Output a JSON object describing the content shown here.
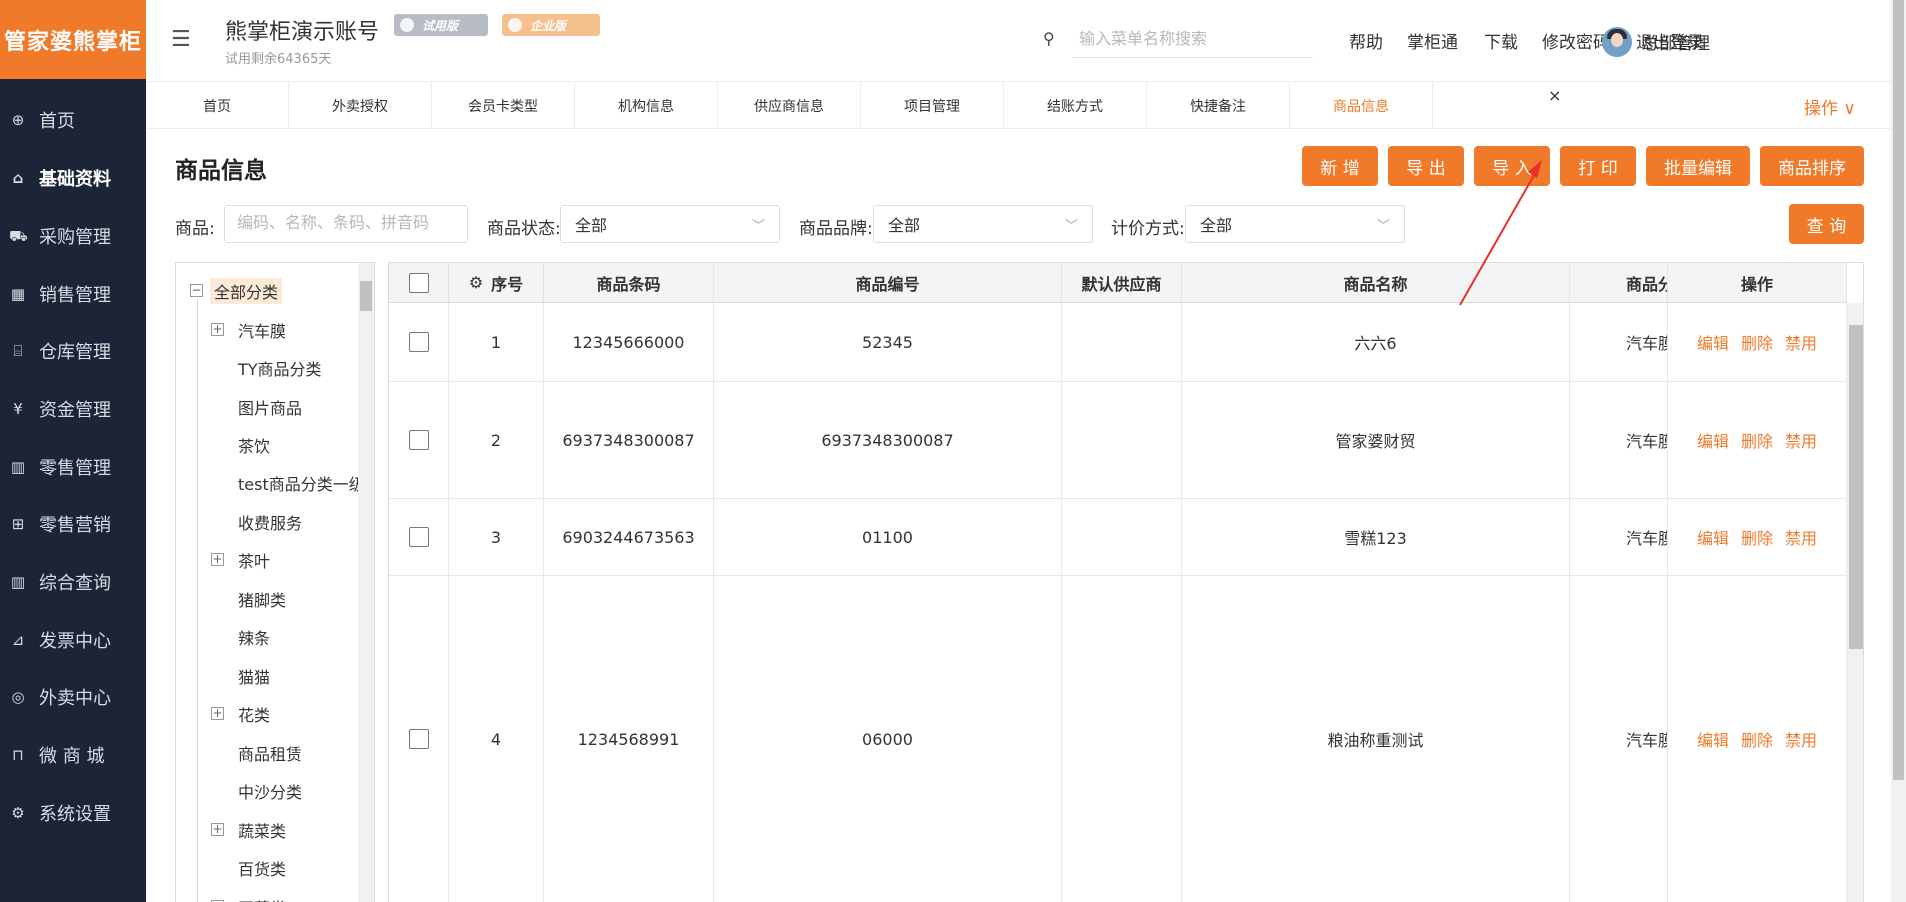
{
  "app": {
    "logo_text": "管家婆熊掌柜",
    "account_name": "熊掌柜演示账号",
    "trial_remaining": "试用剩余64365天",
    "badge_trial": "试用版",
    "badge_enterprise": "企业版",
    "user_name": "总部管理"
  },
  "search": {
    "placeholder": "输入菜单名称搜索"
  },
  "top_links": [
    "帮助",
    "掌柜通",
    "下载",
    "修改密码",
    "退出登录"
  ],
  "sidebar": {
    "items": [
      {
        "label": "首页",
        "icon": "globe-icon"
      },
      {
        "label": "基础资料",
        "icon": "home-icon",
        "active": true
      },
      {
        "label": "采购管理",
        "icon": "cart-icon"
      },
      {
        "label": "销售管理",
        "icon": "calendar-icon"
      },
      {
        "label": "仓库管理",
        "icon": "bank-icon"
      },
      {
        "label": "资金管理",
        "icon": "yen-icon"
      },
      {
        "label": "零售管理",
        "icon": "bar-chart-icon"
      },
      {
        "label": "零售营销",
        "icon": "gift-icon"
      },
      {
        "label": "综合查询",
        "icon": "bar-chart-icon"
      },
      {
        "label": "发票中心",
        "icon": "line-chart-icon"
      },
      {
        "label": "外卖中心",
        "icon": "alarm-icon"
      },
      {
        "label": "微 商 城",
        "icon": "bag-icon"
      },
      {
        "label": "系统设置",
        "icon": "gear-icon"
      }
    ]
  },
  "tabs": [
    {
      "label": "首页"
    },
    {
      "label": "外卖授权"
    },
    {
      "label": "会员卡类型"
    },
    {
      "label": "机构信息"
    },
    {
      "label": "供应商信息"
    },
    {
      "label": "项目管理"
    },
    {
      "label": "结账方式"
    },
    {
      "label": "快捷备注"
    },
    {
      "label": "商品信息",
      "active": true
    }
  ],
  "tab_close": "×",
  "tab_ops": "操作 ∨",
  "page": {
    "title": "商品信息",
    "buttons": [
      "新 增",
      "导 出",
      "导 入",
      "打 印",
      "批量编辑",
      "商品排序"
    ],
    "query_button": "查 询"
  },
  "filters": {
    "goods_label": "商品:",
    "goods_placeholder": "编码、名称、条码、拼音码",
    "status_label": "商品状态:",
    "status_value": "全部",
    "brand_label": "商品品牌:",
    "brand_value": "全部",
    "pricing_label": "计价方式:",
    "pricing_value": "全部"
  },
  "tree": {
    "root": "全部分类",
    "nodes": [
      {
        "label": "汽车膜",
        "expandable": true
      },
      {
        "label": "TY商品分类"
      },
      {
        "label": "图片商品"
      },
      {
        "label": "茶饮"
      },
      {
        "label": "test商品分类一级"
      },
      {
        "label": "收费服务"
      },
      {
        "label": "茶叶",
        "expandable": true
      },
      {
        "label": "猪脚类"
      },
      {
        "label": "辣条"
      },
      {
        "label": "猫猫"
      },
      {
        "label": "花类",
        "expandable": true
      },
      {
        "label": "商品租赁"
      },
      {
        "label": "中沙分类"
      },
      {
        "label": "蔬菜类",
        "expandable": true
      },
      {
        "label": "百货类"
      },
      {
        "label": "田菜类",
        "expandable": true
      }
    ]
  },
  "table": {
    "headers": {
      "seq": "序号",
      "barcode": "商品条码",
      "code": "商品编号",
      "supplier": "默认供应商",
      "name": "商品名称",
      "category": "商品分类",
      "ops": "操作"
    },
    "actions": {
      "edit": "编辑",
      "delete": "删除",
      "disable": "禁用"
    },
    "rows": [
      {
        "seq": "1",
        "barcode": "12345666000",
        "code": "52345",
        "supplier": "",
        "name": "六六6",
        "category": "汽车膜"
      },
      {
        "seq": "2",
        "barcode": "6937348300087",
        "code": "6937348300087",
        "supplier": "",
        "name": "管家婆财贸",
        "category": "汽车膜"
      },
      {
        "seq": "3",
        "barcode": "6903244673563",
        "code": "01100",
        "supplier": "",
        "name": "雪糕123",
        "category": "汽车膜"
      },
      {
        "seq": "4",
        "barcode": "1234568991",
        "code": "06000",
        "supplier": "",
        "name": "粮油称重测试",
        "category": "汽车膜"
      }
    ]
  },
  "colors": {
    "accent": "#f07a2a",
    "sidebar_bg": "#1c2538",
    "annotation_arrow": "#e8302a"
  }
}
